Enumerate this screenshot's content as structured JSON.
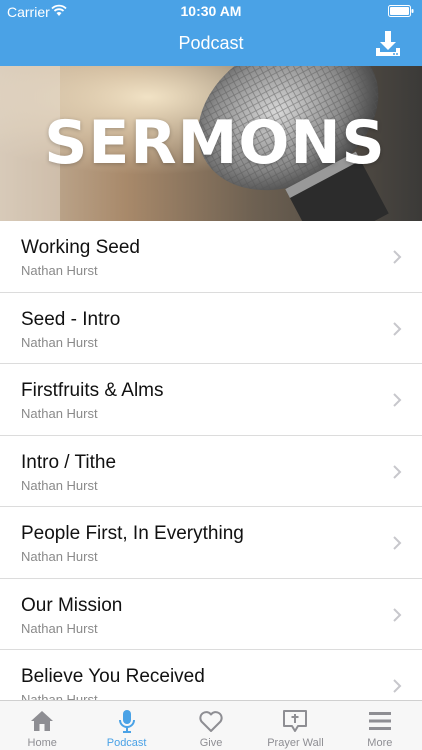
{
  "status_bar": {
    "carrier": "Carrier",
    "time": "10:30 AM"
  },
  "nav": {
    "title": "Podcast",
    "download_icon": "download-icon"
  },
  "banner": {
    "title": "SERMONS"
  },
  "sermons": [
    {
      "title": "Working Seed",
      "author": "Nathan Hurst"
    },
    {
      "title": "Seed - Intro",
      "author": "Nathan Hurst"
    },
    {
      "title": "Firstfruits & Alms",
      "author": "Nathan Hurst"
    },
    {
      "title": "Intro / Tithe",
      "author": "Nathan Hurst"
    },
    {
      "title": "People First, In Everything",
      "author": "Nathan Hurst"
    },
    {
      "title": "Our Mission",
      "author": "Nathan Hurst"
    },
    {
      "title": "Believe You Received",
      "author": "Nathan Hurst"
    }
  ],
  "tabs": [
    {
      "label": "Home",
      "icon": "home-icon"
    },
    {
      "label": "Podcast",
      "icon": "microphone-icon",
      "active": true
    },
    {
      "label": "Give",
      "icon": "heart-icon"
    },
    {
      "label": "Prayer Wall",
      "icon": "prayer-wall-icon"
    },
    {
      "label": "More",
      "icon": "menu-icon"
    }
  ],
  "colors": {
    "accent": "#4aa2e6",
    "inactive_tab": "#8e8e93",
    "divider": "#dcdcdc"
  }
}
